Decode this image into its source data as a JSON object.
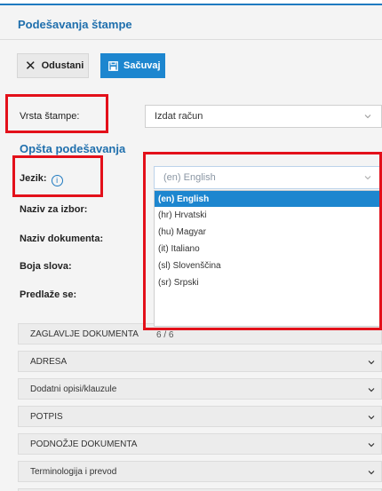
{
  "page": {
    "title": "Podešavanja štampe"
  },
  "toolbar": {
    "cancel_label": "Odustani",
    "save_label": "Sačuvaj"
  },
  "form": {
    "print_type": {
      "label": "Vrsta štampe:",
      "value": "Izdat račun"
    },
    "section_title": "Opšta podešavanja",
    "language": {
      "label": "Jezik:",
      "value": "(en) English"
    },
    "name_for_selection": {
      "label": "Naziv za izbor:"
    },
    "document_name": {
      "label": "Naziv dokumenta:"
    },
    "font_color": {
      "label": "Boja slova:"
    },
    "suggested": {
      "label": "Predlaže se:"
    }
  },
  "dropdown": {
    "options": [
      "(en) English",
      "(hr) Hrvatski",
      "(hu) Magyar",
      "(it) Italiano",
      "(sl) Slovenščina",
      "(sr) Srpski"
    ],
    "selected_index": 0,
    "count": "6 / 6"
  },
  "accordion": [
    "ZAGLAVLJE DOKUMENTA",
    "ADRESA",
    "Dodatni opisi/klauzule",
    "POTPIS",
    "PODNOŽJE DOKUMENTA",
    "Terminologija i prevod"
  ],
  "colors": {
    "accent": "#1d86cf",
    "title": "#1f6fad",
    "highlight": "#e3101a"
  },
  "icons": {
    "cancel": "close-icon",
    "save": "save-icon",
    "info": "info-icon",
    "expand": "chevron-down-icon"
  }
}
